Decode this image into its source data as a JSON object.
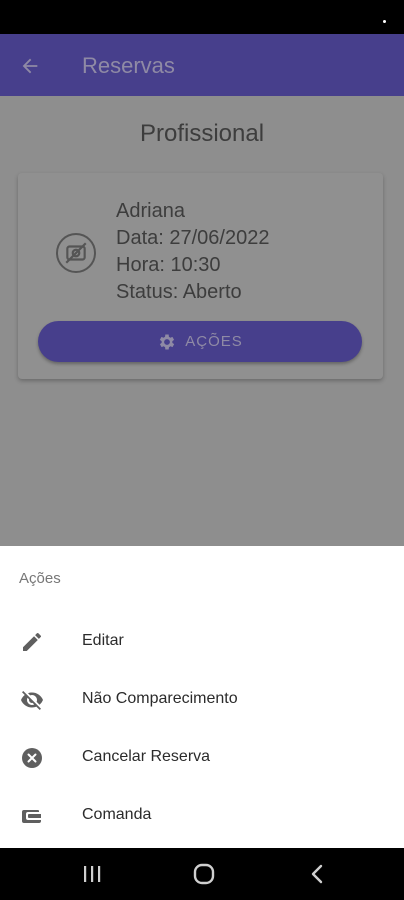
{
  "app_bar": {
    "title": "Reservas",
    "back_icon": "arrow-left-icon"
  },
  "content": {
    "section_title": "Profissional",
    "card": {
      "name": "Adriana",
      "date": "Data: 27/06/2022",
      "time": "Hora: 10:30",
      "status": "Status: Aberto",
      "photo_icon": "no-photo-icon",
      "actions_label": "AÇÕES",
      "actions_icon": "gear-icon"
    }
  },
  "sheet": {
    "title": "Ações",
    "items": [
      {
        "label": "Editar",
        "icon": "pencil-icon"
      },
      {
        "label": "Não Comparecimento",
        "icon": "eye-off-icon"
      },
      {
        "label": "Cancelar Reserva",
        "icon": "close-circle-icon"
      },
      {
        "label": "Comanda",
        "icon": "wallet-icon"
      }
    ]
  },
  "nav_bar": {
    "icons": [
      "recents-icon",
      "home-icon",
      "back-icon"
    ]
  },
  "colors": {
    "primary": "#473f8c",
    "scrim": "#8e8e8e",
    "sheet_bg": "#ffffff"
  }
}
